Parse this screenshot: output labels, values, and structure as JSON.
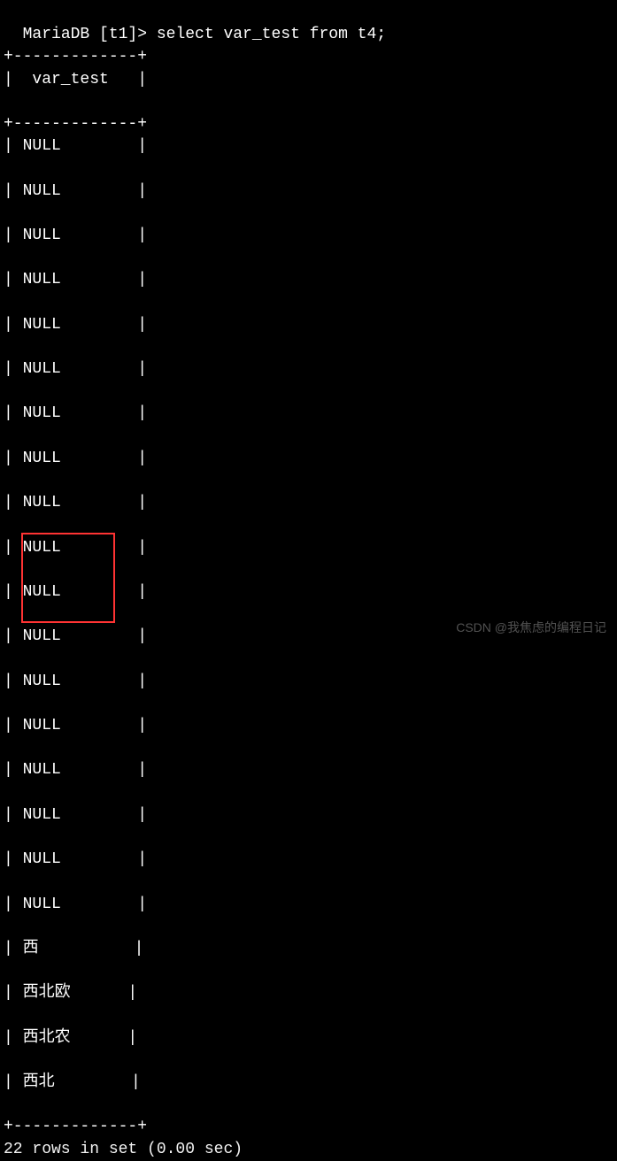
{
  "prompt": {
    "prefix": "MariaDB [t1]> ",
    "command": "select var_test from t4;"
  },
  "table": {
    "sep": "+-------------+",
    "header": "|  var_test   |",
    "rows": [
      "| NULL        |",
      "| NULL        |",
      "| NULL        |",
      "| NULL        |",
      "| NULL        |",
      "| NULL        |",
      "| NULL        |",
      "| NULL        |",
      "| NULL        |",
      "| NULL        |",
      "| NULL        |",
      "| NULL        |",
      "| NULL        |",
      "| NULL        |",
      "| NULL        |",
      "| NULL        |",
      "| NULL        |",
      "| NULL        |",
      "| 西          |",
      "| 西北欧      |",
      "| 西北农      |",
      "| 西北        |"
    ]
  },
  "footer_partial": "22 rows in set (0.00 sec)",
  "watermark": "CSDN @我焦虑的编程日记"
}
